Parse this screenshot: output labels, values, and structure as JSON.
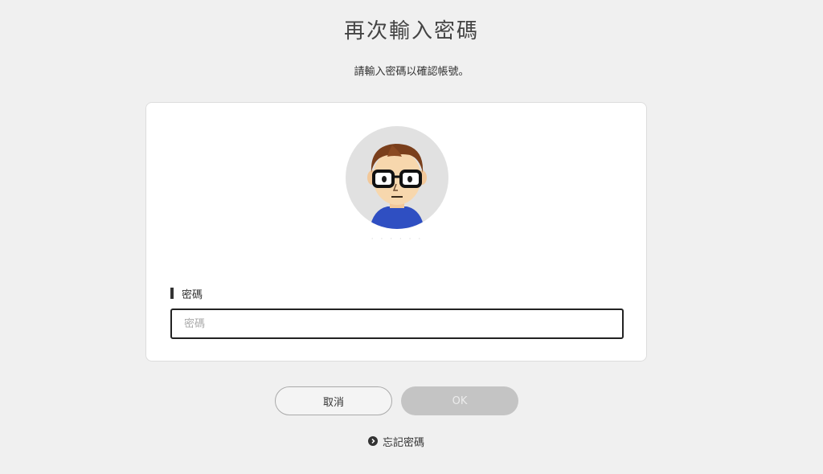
{
  "header": {
    "title": "再次輸入密碼",
    "subtitle": "請輸入密碼以確認帳號。"
  },
  "account": {
    "avatar_icon": "mii-avatar-icon",
    "username": "· · · · · ·"
  },
  "password_field": {
    "label": "密碼",
    "placeholder": "密碼",
    "value": ""
  },
  "buttons": {
    "cancel_label": "取消",
    "ok_label": "OK"
  },
  "forgot": {
    "icon": "chevron-right-circle-icon",
    "label": "忘記密碼"
  },
  "colors": {
    "background": "#f0f0f0",
    "card": "#ffffff",
    "ok_disabled": "#c4c4c4",
    "avatar_shirt": "#2f4fc2"
  }
}
